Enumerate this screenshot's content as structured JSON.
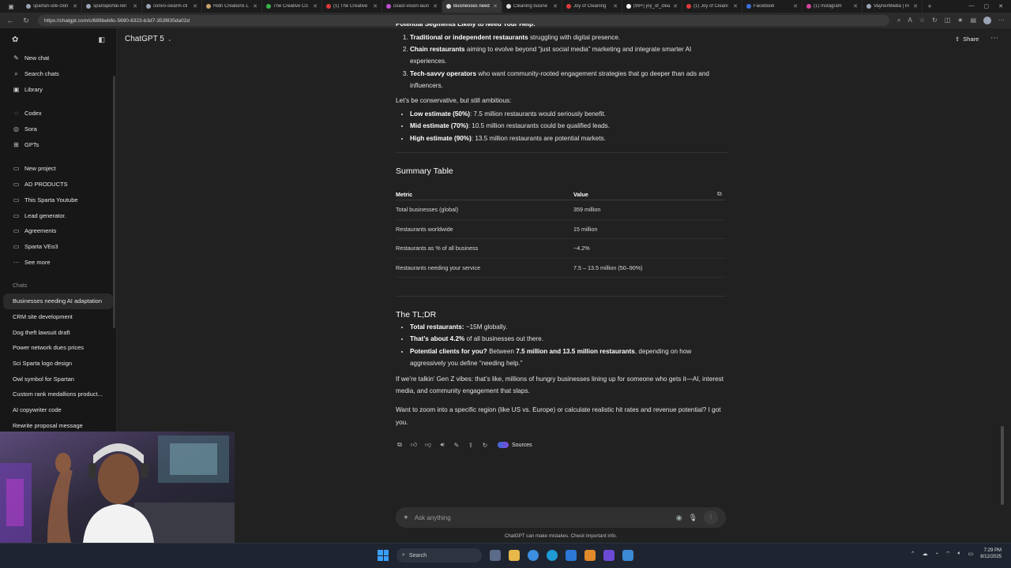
{
  "browser": {
    "tabs": [
      {
        "label": "spartan-site-clon",
        "color": "#9aa4b5"
      },
      {
        "label": "spartaportal-ren",
        "color": "#9aa4b5"
      },
      {
        "label": "convo-swarm-cli",
        "color": "#9aa4b5"
      },
      {
        "label": "Hidn Creations L",
        "color": "#c9a16b"
      },
      {
        "label": "The Creative Co",
        "color": "#39b54a"
      },
      {
        "label": "(1) The Creative",
        "color": "#e03b3b"
      },
      {
        "label": "coast-vision-laun",
        "color": "#c04fd6"
      },
      {
        "label": "Businesses need",
        "color": "#dddddd"
      },
      {
        "label": "Cleaning busine",
        "color": "#dddddd"
      },
      {
        "label": "Joy of Cleaning",
        "color": "#e03b3b"
      },
      {
        "label": "(99+) joy_of_clea",
        "color": "#ffffff"
      },
      {
        "label": "(1) Joy of Cleani",
        "color": "#e03b3b"
      },
      {
        "label": "Facebook",
        "color": "#3b6fe0"
      },
      {
        "label": "(1) Instagram",
        "color": "#d6449c"
      },
      {
        "label": "VaynerMedia | In",
        "color": "#9aa4b5"
      }
    ],
    "active_tab_index": 7,
    "url": "https://chatgpt.com/c/689beb6c-5690-8323-b3d7-353f835da02d"
  },
  "sidebar": {
    "primary": [
      {
        "label": "New chat",
        "icon": "new-chat-icon",
        "glyph": "✎"
      },
      {
        "label": "Search chats",
        "icon": "search-icon",
        "glyph": "⌕"
      },
      {
        "label": "Library",
        "icon": "library-icon",
        "glyph": "▣"
      }
    ],
    "tools": [
      {
        "label": "Codex",
        "icon": "codex-icon",
        "glyph": "◌"
      },
      {
        "label": "Sora",
        "icon": "sora-icon",
        "glyph": "◎"
      },
      {
        "label": "GPTs",
        "icon": "gpts-icon",
        "glyph": "⊞"
      }
    ],
    "projects": [
      {
        "label": "New project",
        "icon": "folder-plus-icon",
        "glyph": "▭"
      },
      {
        "label": "AD PRODUCTS",
        "icon": "folder-icon",
        "glyph": "▭"
      },
      {
        "label": "This Sparta Youtube",
        "icon": "folder-icon",
        "glyph": "▭"
      },
      {
        "label": "Lead generator.",
        "icon": "folder-icon",
        "glyph": "▭"
      },
      {
        "label": "Agreements",
        "icon": "folder-icon",
        "glyph": "▭"
      },
      {
        "label": "Sparta VEo3",
        "icon": "folder-icon",
        "glyph": "▭"
      },
      {
        "label": "See more",
        "icon": "more-dots-icon",
        "glyph": "···"
      }
    ],
    "chats_heading": "Chats",
    "chats": [
      "Businesses needing AI adaptation",
      "CRM site development",
      "Dog theft lawsuit draft",
      "Power network dues prices",
      "Sci Sparta logo design",
      "Owl symbol for Spartan",
      "Custom rank medallions product...",
      "AI copywriter code",
      "Rewrite proposal message"
    ]
  },
  "header": {
    "model": "ChatGPT 5",
    "share": "Share"
  },
  "conversation": {
    "partial_heading": "Potential Segments Likely to Need Your Help:",
    "segments": [
      {
        "bold": "Traditional or independent restaurants",
        "rest": " struggling with digital presence."
      },
      {
        "bold": "Chain restaurants",
        "rest": " aiming to evolve beyond “just social media” marketing and integrate smarter AI experiences."
      },
      {
        "bold": "Tech-savvy operators",
        "rest": " who want community-rooted engagement strategies that go deeper than ads and influencers."
      }
    ],
    "conservative": "Let’s be conservative, but still ambitious:",
    "estimates": [
      {
        "bold": "Low estimate (50%)",
        "rest": ": 7.5 million restaurants would seriously benefit."
      },
      {
        "bold": "Mid estimate (70%)",
        "rest": ": 10.5 million restaurants could be qualified leads."
      },
      {
        "bold": "High estimate (90%)",
        "rest": ": 13.5 million restaurants are potential markets."
      }
    ],
    "summary_title": "Summary Table",
    "table": {
      "headers": [
        "Metric",
        "Value"
      ],
      "rows": [
        [
          "Total businesses (global)",
          "359 million"
        ],
        [
          "Restaurants worldwide",
          "15 million"
        ],
        [
          "Restaurants as % of all business",
          "~4.2%"
        ],
        [
          "Restaurants needing your service",
          "7.5 – 13.5 million (50–90%)"
        ]
      ]
    },
    "tldr_title": "The TL;DR",
    "tldr": [
      {
        "bold": "Total restaurants:",
        "rest": " ~15M globally."
      },
      {
        "bold": "That’s about 4.2%",
        "rest": " of all businesses out there."
      },
      {
        "bold": "Potential clients for you?",
        "rest": " Between ",
        "bold2": "7.5 million and 13.5 million restaurants",
        "rest2": ", depending on how aggressively you define “needing help.”"
      }
    ],
    "vibes": "If we’re talkin’ Gen Z vibes: that’s like, millions of hungry businesses lining up for someone who gets it—AI, interest media, and community engagement that slaps.",
    "closing": "Want to zoom into a specific region (like US vs. Europe) or calculate realistic hit rates and revenue potential? I got you.",
    "sources_label": "Sources"
  },
  "composer": {
    "placeholder": "Ask anything",
    "disclaimer": "ChatGPT can make mistakes. Check important info."
  },
  "taskbar": {
    "search_label": "Search",
    "time": "7:29 PM",
    "date": "8/12/2025"
  }
}
